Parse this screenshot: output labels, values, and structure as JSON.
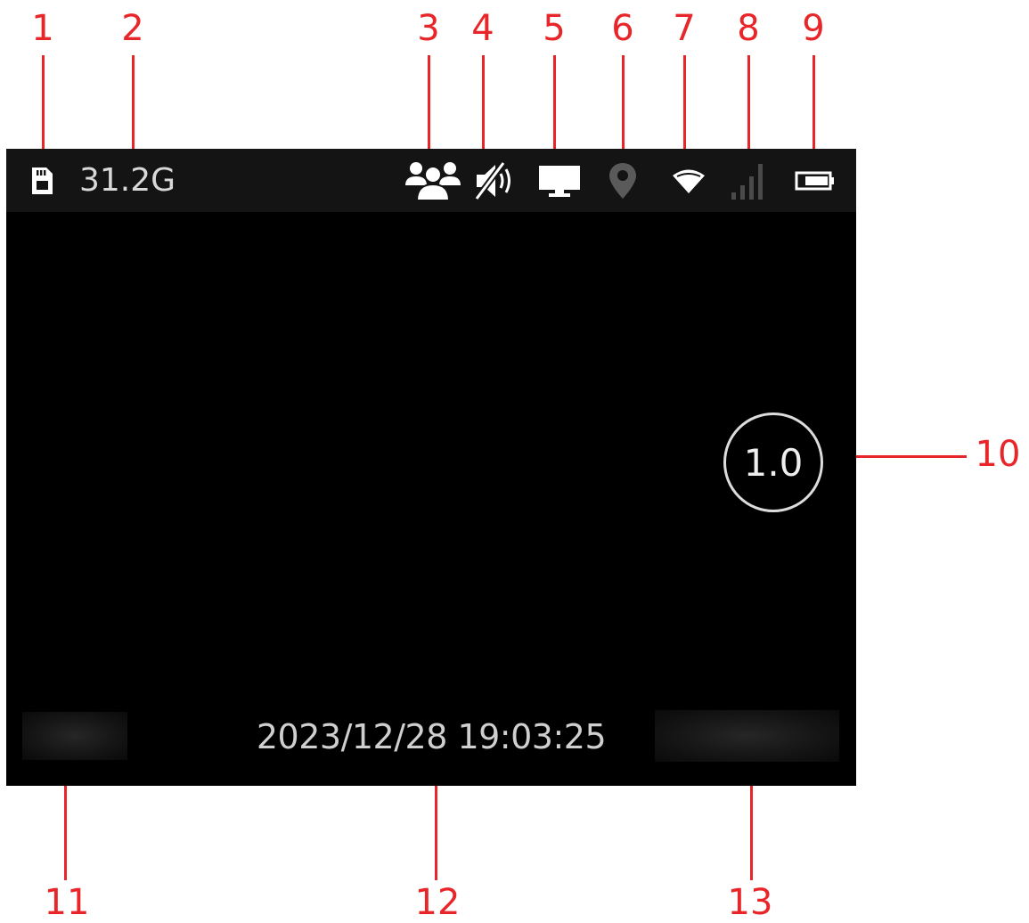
{
  "callouts": [
    "1",
    "2",
    "3",
    "4",
    "5",
    "6",
    "7",
    "8",
    "9",
    "10",
    "11",
    "12",
    "13"
  ],
  "status_bar": {
    "storage_icon": "sd-card-icon",
    "storage_text": "31.2G",
    "icons": [
      "users-icon",
      "mute-icon",
      "monitor-icon",
      "location-pin-icon",
      "wifi-icon",
      "signal-bars-icon",
      "battery-icon"
    ]
  },
  "zoom_indicator": "1.0",
  "datetime": "2023/12/28 19:03:25",
  "colors": {
    "callout": "#e8262a",
    "screen_bg": "#000000",
    "status_bar_bg": "#141414",
    "icon_active": "#ffffff",
    "icon_inactive": "#5a5a5a"
  }
}
